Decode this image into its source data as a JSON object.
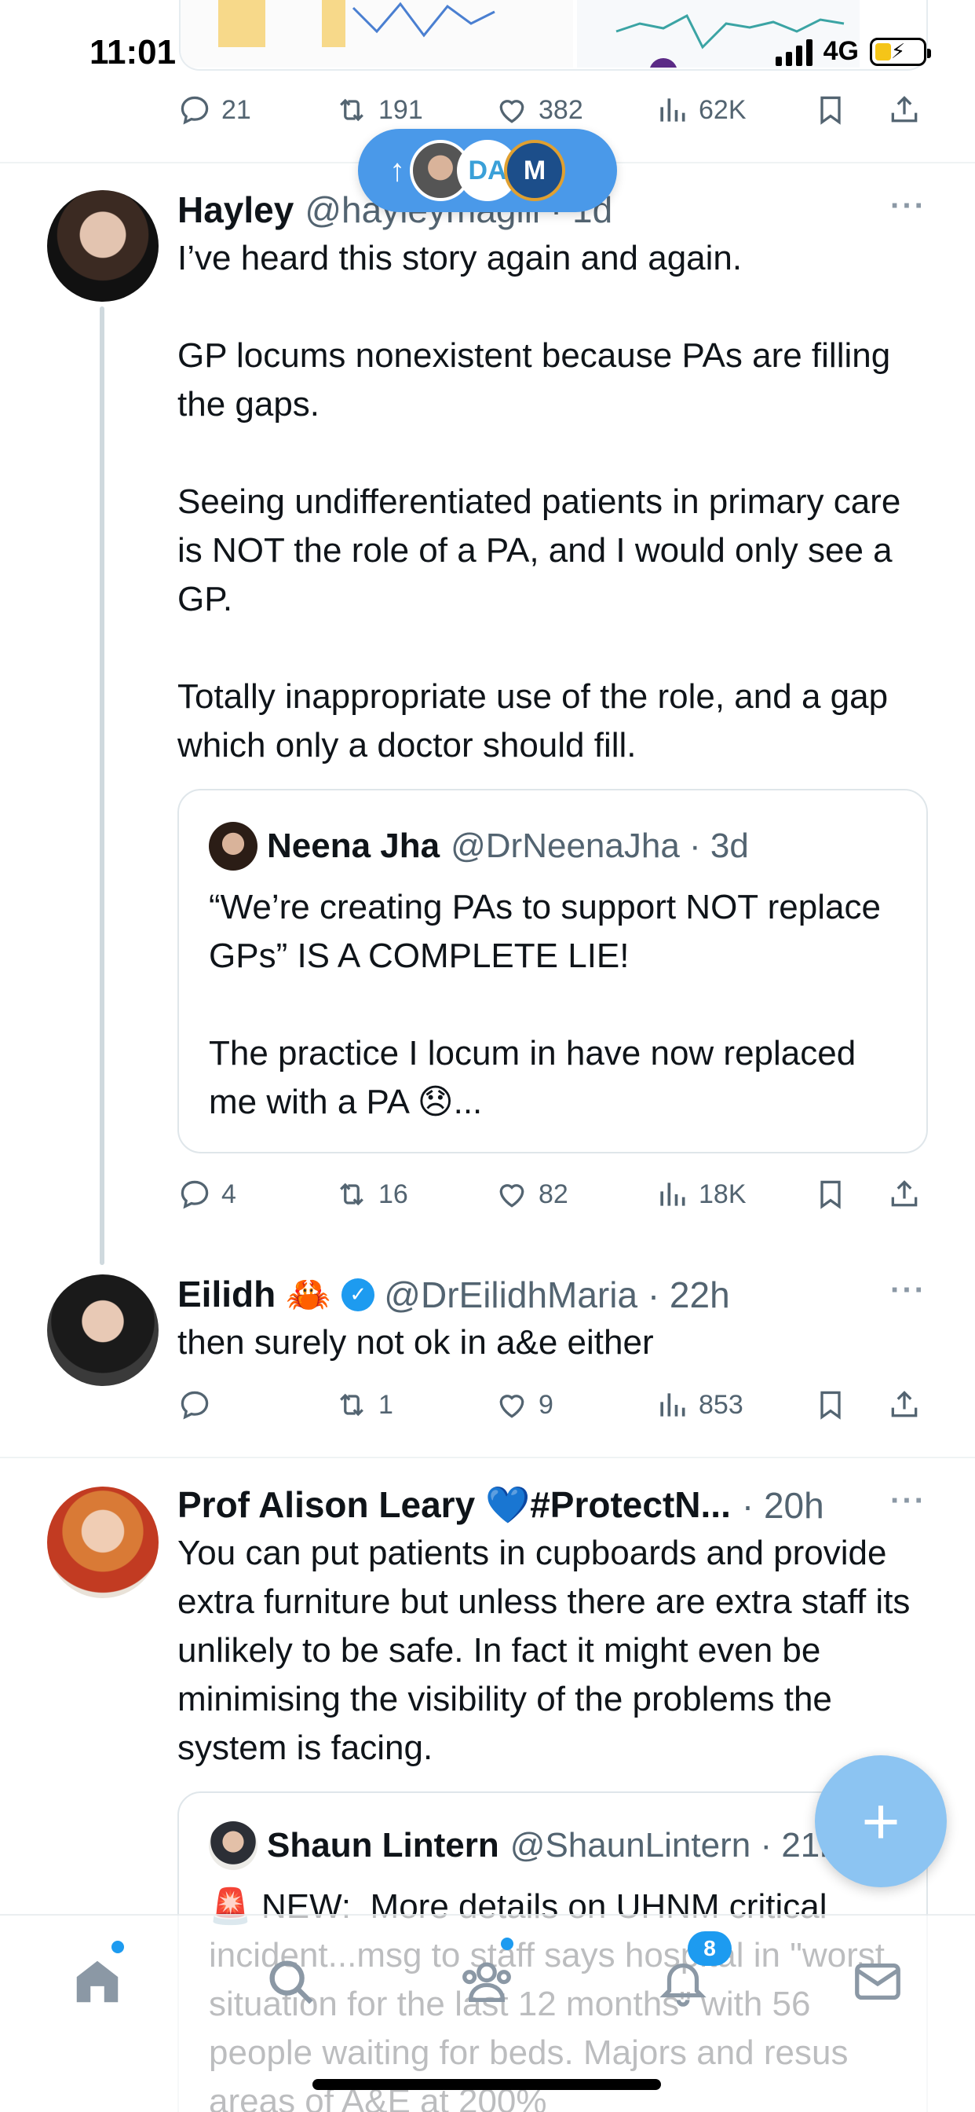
{
  "status_bar": {
    "time": "11:01",
    "network": "4G"
  },
  "top_actions": {
    "replies": "21",
    "reposts": "191",
    "likes": "382",
    "views": "62K"
  },
  "new_posts_pill": {
    "arrow": "↑",
    "avatar_2_label": "DA",
    "avatar_3_label": "M"
  },
  "tweets": [
    {
      "name": "Hayley",
      "handle": "@hayleymagill · 1d",
      "text": "I’ve heard this story again and again.\n\nGP locums nonexistent because PAs are filling the gaps.\n\nSeeing undifferentiated patients in primary care is NOT the role of a PA, and I would only see a GP.\n\nTotally inappropriate use of the role, and a gap which only a doctor should fill.",
      "quote": {
        "name": "Neena Jha",
        "handle": "@DrNeenaJha · 3d",
        "text": "“We’re creating PAs to support NOT replace GPs” IS A COMPLETE LIE!\n\nThe practice I locum in have now replaced me with a PA 😞..."
      },
      "actions": {
        "replies": "4",
        "reposts": "16",
        "likes": "82",
        "views": "18K"
      }
    },
    {
      "name": "Eilidh 🦀",
      "handle": "@DrEilidhMaria · 22h",
      "text": "then surely not ok in a&e either",
      "actions": {
        "replies": "",
        "reposts": "1",
        "likes": "9",
        "views": "853"
      }
    },
    {
      "name": "Prof Alison Leary 💙#ProtectN...",
      "handle": "· 20h",
      "text": "You can put patients in cupboards and provide extra furniture but unless there are extra staff its unlikely to be safe. In fact it might even be minimising the visibility of the problems the system is facing.",
      "quote": {
        "name": "Shaun Lintern",
        "handle": "@ShaunLintern · 21h",
        "text": "🚨 NEW:  More details on UHNM critical incident...msg to staff says hospital in \"worst situation for the last 12 months\" with 56 people waiting for beds. Majors and resus areas of A&E at 200%"
      }
    }
  ],
  "more_label": "···",
  "fab_label": "+",
  "tabbar": {
    "notifications_badge": "8"
  },
  "colors": {
    "accent": "#1d9bf0",
    "pill": "#4a99e9",
    "fab": "#8cc4f2",
    "muted": "#536471"
  },
  "icons": [
    "reply-icon",
    "repost-icon",
    "like-icon",
    "views-icon",
    "bookmark-icon",
    "share-icon",
    "home-icon",
    "search-icon",
    "communities-icon",
    "notifications-icon",
    "messages-icon",
    "compose-icon"
  ]
}
